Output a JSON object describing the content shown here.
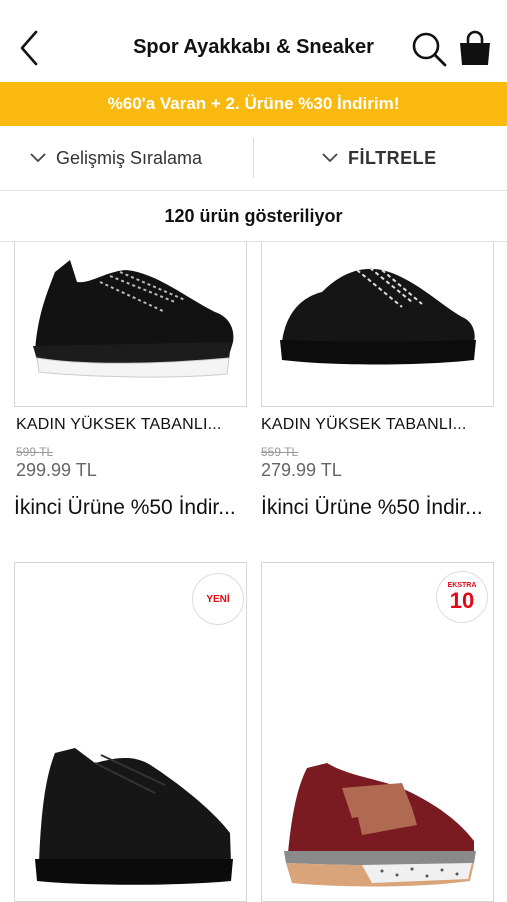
{
  "header": {
    "title": "Spor Ayakkabı & Sneaker",
    "back_icon": "chevron-left-icon",
    "search_icon": "search-icon",
    "bag_icon": "shopping-bag-icon"
  },
  "promo_banner": {
    "text": "%60'a Varan + 2. Ürüne %30 İndirim!",
    "bg_color": "#f9b90e"
  },
  "toolbar": {
    "sort_label": "Gelişmiş Sıralama",
    "filter_label": "FİLTRELE"
  },
  "results": {
    "count_text": "120 ürün gösteriliyor"
  },
  "products": [
    {
      "name": "KADIN YÜKSEK TABANLI...",
      "old_price": "599 TL",
      "price": "299.99 TL",
      "promo": "İkinci Ürüne %50 İndir..."
    },
    {
      "name": "KADIN YÜKSEK TABANLI...",
      "old_price": "559 TL",
      "price": "279.99 TL",
      "promo": "İkinci Ürüne %50 İndir..."
    },
    {
      "badge": "YENİ"
    },
    {
      "badge_top": "EKSTRA",
      "badge_num": "10"
    }
  ]
}
